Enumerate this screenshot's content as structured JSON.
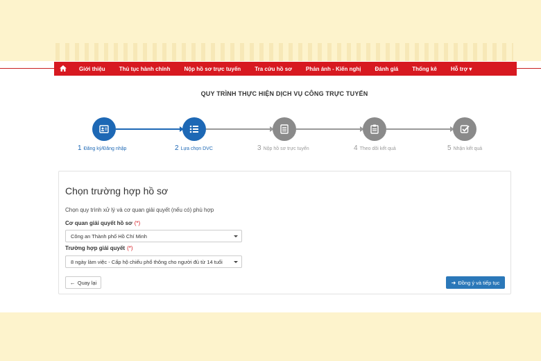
{
  "nav": {
    "home_icon": "home-icon",
    "items": [
      "Giới thiệu",
      "Thủ tục hành chính",
      "Nộp hồ sơ trực tuyến",
      "Tra cứu hồ sơ",
      "Phản ánh - Kiến nghị",
      "Đánh giá",
      "Thống kê",
      "Hỗ trợ ▾"
    ]
  },
  "title": "QUY TRÌNH THỰC HIỆN DỊCH VỤ CÔNG TRỰC TUYẾN",
  "steps": [
    {
      "num": "1",
      "label": "Đăng ký/Đăng nhập",
      "icon": "id-card-icon",
      "state": "active"
    },
    {
      "num": "2",
      "label": "Lựa chọn DVC",
      "icon": "list-icon",
      "state": "active"
    },
    {
      "num": "3",
      "label": "Nộp hồ sơ trực tuyến",
      "icon": "document-icon",
      "state": "inactive"
    },
    {
      "num": "4",
      "label": "Theo dõi kết quả",
      "icon": "clipboard-icon",
      "state": "inactive"
    },
    {
      "num": "5",
      "label": "Nhận kết quả",
      "icon": "checkbox-icon",
      "state": "inactive"
    }
  ],
  "panel": {
    "title": "Chọn trường hợp hồ sơ",
    "description": "Chọn quy trình xử lý và cơ quan giải quyết (nếu có) phù hợp",
    "agency_label": "Cơ quan giải quyết hồ sơ",
    "agency_required": "(*)",
    "agency_value": "Công an Thành phố Hồ Chí Minh",
    "case_label": "Trường hợp giải quyết",
    "case_required": "(*)",
    "case_value": "8 ngày làm việc - Cấp hộ chiếu phổ thông cho người đủ từ 14 tuổi",
    "back_label": "Quay lại",
    "next_label": "Đồng ý và tiếp tục"
  },
  "colors": {
    "nav_bg": "#d71920",
    "active": "#1d68b5",
    "inactive": "#8a8a8a",
    "primary_button": "#2b78b9",
    "banner": "#fdf3cc"
  }
}
